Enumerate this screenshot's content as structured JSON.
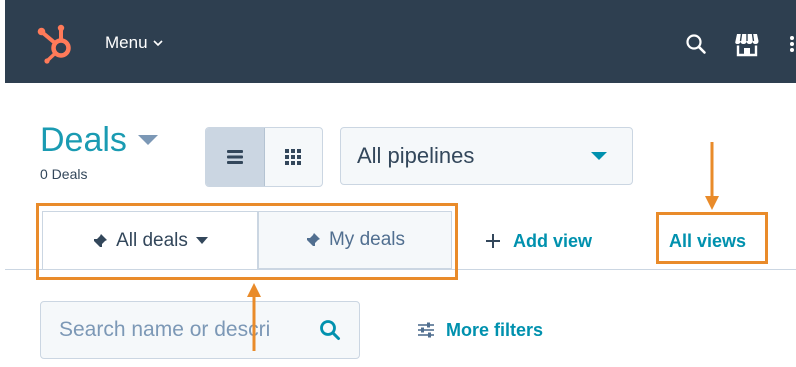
{
  "topnav": {
    "logo_icon": "hubspot-sprocket-icon",
    "menu_label": "Menu",
    "search_icon": "search-icon",
    "marketplace_icon": "marketplace-store-icon",
    "bg_color": "#2e3f50",
    "accent_color": "#ff7a59"
  },
  "header": {
    "title": "Deals",
    "count_label": "0 Deals",
    "view_toggle": {
      "options": [
        "list-view-icon",
        "board-view-icon"
      ],
      "selected": "list-view-icon"
    },
    "pipeline_select": {
      "value": "All pipelines"
    }
  },
  "tabs": {
    "items": [
      {
        "label": "All deals",
        "pinned": true,
        "active": true,
        "has_dropdown": true
      },
      {
        "label": "My deals",
        "pinned": true,
        "active": false,
        "has_dropdown": false
      }
    ],
    "add_view_label": "Add view",
    "all_views_label": "All views"
  },
  "filters": {
    "search_placeholder": "Search name or descri",
    "more_filters_label": "More filters"
  },
  "annotation_color": "#e98b2a",
  "link_color": "#0091ae",
  "title_color": "#1a9bb2"
}
